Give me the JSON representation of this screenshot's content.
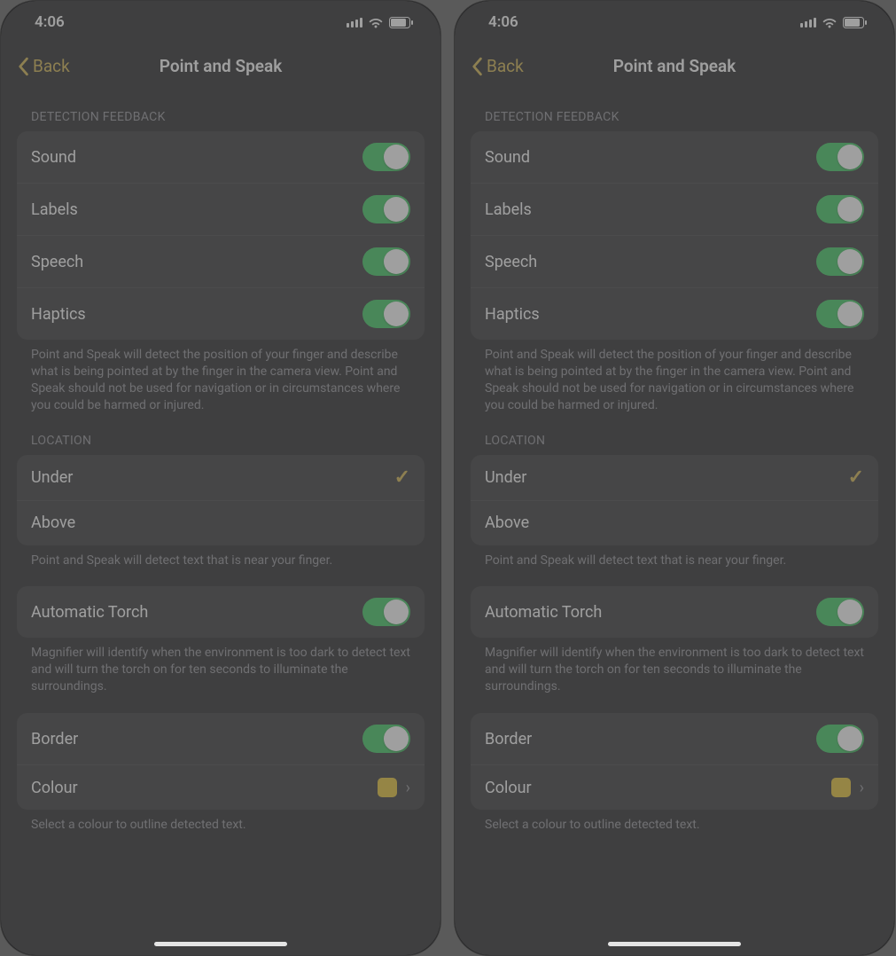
{
  "status": {
    "time": "4:06"
  },
  "nav": {
    "back": "Back",
    "title": "Point and Speak"
  },
  "sections": {
    "feedback": {
      "header": "DETECTION FEEDBACK",
      "rows": [
        "Sound",
        "Labels",
        "Speech",
        "Haptics"
      ],
      "footer": "Point and Speak will detect the position of your finger and describe what is being pointed at by the finger in the camera view. Point and Speak should not be used for navigation or in circumstances where you could be harmed or injured."
    },
    "location": {
      "header": "LOCATION",
      "rows": [
        "Under",
        "Above"
      ],
      "footer": "Point and Speak will detect text that is near your finger."
    },
    "torch": {
      "label": "Automatic Torch",
      "footer": "Magnifier will identify when the environment is too dark to detect text and will turn the torch on for ten seconds to illuminate the surroundings."
    },
    "border": {
      "border_label": "Border",
      "colour_label": "Colour",
      "swatch": "#e8c02a",
      "footer": "Select a colour to outline detected text."
    }
  }
}
